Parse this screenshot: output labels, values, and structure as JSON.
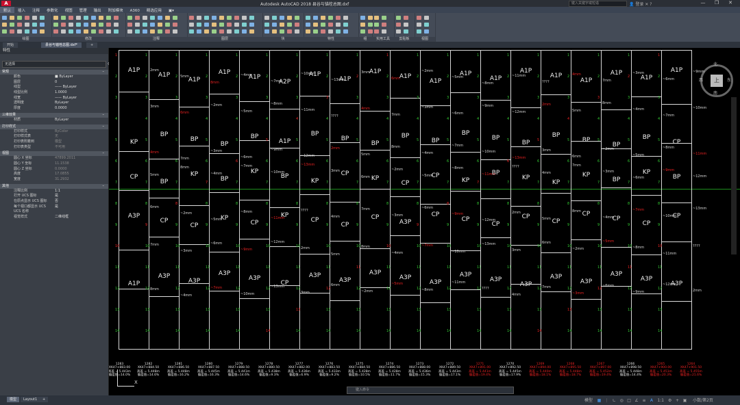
{
  "window": {
    "title": "Autodesk AutoCAD 2018    县谷与锚栓总图.dxf",
    "search_placeholder": "键入关键字或短语",
    "user": "登录",
    "controls": [
      "—",
      "❐",
      "✕"
    ]
  },
  "menu": [
    "默认",
    "插入",
    "注释",
    "参数化",
    "视图",
    "管理",
    "输出",
    "附加模块",
    "A360",
    "精选应用",
    "▣▾"
  ],
  "menu_active_index": 0,
  "ribbon": {
    "groups": [
      "绘图",
      "修改",
      "注释",
      "图层",
      "块",
      "特性",
      "组",
      "实用工具",
      "剪贴板",
      "视图"
    ],
    "draw_tools": [
      "直线",
      "多段线",
      "圆",
      "圆弧"
    ],
    "modify_tools": [
      "移动",
      "旋转",
      "修剪",
      "复制",
      "镜像",
      "圆角",
      "拉伸",
      "缩放",
      "阵列"
    ],
    "annot_tools": [
      "文字",
      "标注",
      "线性",
      "引线",
      "表格"
    ],
    "layer_tools": [
      "图层特性",
      "置为当前",
      "匹配图层"
    ],
    "block_tools": [
      "插入",
      "创建",
      "编辑",
      "编辑属性"
    ],
    "property_tools": [
      "特性匹配",
      "ByLayer",
      "ByLayer",
      "ByLayer"
    ],
    "group_tools": [
      "组"
    ],
    "util_tools": [
      "测量"
    ],
    "clip_tools": [
      "粘贴"
    ],
    "view_tools": [
      "基点"
    ]
  },
  "file_tabs": [
    "开始",
    "县谷与锚栓总图.dxf*",
    "+"
  ],
  "file_tab_active": 1,
  "palette": {
    "title": "特性",
    "selection": "无选择",
    "sections": [
      {
        "name": "常规",
        "rows": [
          [
            "颜色",
            "■ ByLayer"
          ],
          [
            "图层",
            "0"
          ],
          [
            "线型",
            "—— ByLayer"
          ],
          [
            "线型比例",
            "1.0000"
          ],
          [
            "线宽",
            "—— ByLayer"
          ],
          [
            "透明度",
            "ByLayer"
          ],
          [
            "厚度",
            "0.0000"
          ]
        ]
      },
      {
        "name": "三维效果",
        "rows": [
          [
            "材质",
            "ByLayer"
          ]
        ]
      },
      {
        "name": "打印样式",
        "rows": [
          [
            "打印样式",
            "ByColor"
          ],
          [
            "打印样式表",
            "无"
          ],
          [
            "打印表附着到",
            "模型"
          ],
          [
            "打印表类型",
            "不可用"
          ]
        ]
      },
      {
        "name": "视图",
        "rows": [
          [
            "圆心 X 坐标",
            "47899.2011"
          ],
          [
            "圆心 Y 坐标",
            "11.1538"
          ],
          [
            "圆心 Z 坐标",
            "0.0000"
          ],
          [
            "高度",
            "17.0855"
          ],
          [
            "宽度",
            "31.2932"
          ]
        ]
      },
      {
        "name": "其他",
        "rows": [
          [
            "注释比例",
            "1:1"
          ],
          [
            "打开 UCS 图标",
            "是"
          ],
          [
            "在原点显示 UCS 图标",
            "否"
          ],
          [
            "每个视口都显示 UCS",
            "是"
          ],
          [
            "UCS 名称",
            ""
          ],
          [
            "视觉样式",
            "二维线框"
          ]
        ]
      }
    ]
  },
  "canvas": {
    "columns": [
      {
        "labels": [
          "A1P",
          "KP",
          "CP",
          "A3P",
          "A1P"
        ],
        "info": [
          "1282",
          "XK47+884.50",
          "高差 = 5.448m",
          "偏差值=14.6%"
        ],
        "red": false
      },
      {
        "labels": [
          "A1P",
          "BP",
          "BP",
          "CP",
          "A3P"
        ],
        "info": [
          "1281",
          "XK47+886.50",
          "高差 = 5.448m",
          "偏差值=16.2%"
        ],
        "red": false
      },
      {
        "labels": [
          "A1P",
          "BP",
          "KP",
          "CP",
          "A3P"
        ],
        "info": [
          "1280",
          "XK47+887.50",
          "高差 = 5.445m",
          "偏差值=16.3%"
        ],
        "red": false
      },
      {
        "labels": [
          "A1P",
          "BP",
          "BP",
          "KP",
          "A3P"
        ],
        "info": [
          "1279",
          "XK47+888.50",
          "高差 = 5.441m",
          "偏差值=14.6%"
        ],
        "red": false
      },
      {
        "labels": [
          "A1P",
          "BP",
          "KP",
          "CP",
          "A3P"
        ],
        "info": [
          "1278",
          "XK47+880.50",
          "高差 = 5.438m",
          "偏差值=9.3%"
        ],
        "red": false
      },
      {
        "labels": [
          "A2P",
          "A1P",
          "BP",
          "KP",
          "CP"
        ],
        "info": [
          "1277",
          "XK47+882.00",
          "高差 = 5.436m",
          "偏差值=6.9%"
        ],
        "red": false
      },
      {
        "labels": [
          "A1P",
          "BP",
          "KP",
          "CP",
          "A3P"
        ],
        "info": [
          "1276",
          "XK47+883.50",
          "高差 = 5.433m",
          "偏差值=9.2%"
        ],
        "red": false
      },
      {
        "labels": [
          "A1P",
          "BP",
          "CP",
          "CP",
          "A3P"
        ],
        "info": [
          "1275",
          "XK47+884.50",
          "高差 = 5.428m",
          "偏差值=10.5%"
        ],
        "red": false
      },
      {
        "labels": [
          "A1P",
          "BP",
          "KP",
          "CP",
          "A3P"
        ],
        "info": [
          "1274",
          "XK47+886.50",
          "高差 = 5.428m",
          "偏差值=11.7%"
        ],
        "red": false
      },
      {
        "labels": [
          "A1P",
          "BP",
          "CP",
          "A3P",
          "A3P"
        ],
        "info": [
          "1273",
          "XK47+888.00",
          "高差 = 5.436m",
          "偏差值=15.3%"
        ],
        "red": false
      },
      {
        "labels": [
          "A1P",
          "BP",
          "CP",
          "CP",
          "A3P"
        ],
        "info": [
          "1272",
          "XK47+889.50",
          "高差 = 5.443m",
          "偏差值=17.1%"
        ],
        "red": false
      },
      {
        "labels": [
          "A1P",
          "BP",
          "KP",
          "CP",
          "A3P"
        ],
        "info": [
          "1271",
          "XK47+891.00",
          "高差 = 5.441m",
          "偏差值=19.4%"
        ],
        "red": true
      },
      {
        "labels": [
          "A1P",
          "BP",
          "BP",
          "CP",
          "A3P"
        ],
        "info": [
          "1270",
          "XK47+892.50",
          "高差 = 5.445m",
          "偏差值=17.9%"
        ],
        "red": false
      },
      {
        "labels": [
          "A1P",
          "BP",
          "KP",
          "CP",
          "A3P"
        ],
        "info": [
          "1269",
          "XK47+894.00",
          "高差 = 5.440m",
          "偏差值=18.1%"
        ],
        "red": true
      },
      {
        "labels": [
          "A1P",
          "BP",
          "KP",
          "CP",
          "A3P"
        ],
        "info": [
          "1268",
          "XK47+895.50",
          "高差 = 5.448m",
          "偏差值=18.7%"
        ],
        "red": true
      },
      {
        "labels": [
          "A1P",
          "BP",
          "KP",
          "CP",
          "A3P"
        ],
        "info": [
          "1267",
          "XK47+897.00",
          "高差 = 5.452m",
          "偏差值=19.4%"
        ],
        "red": true
      },
      {
        "labels": [
          "A1P",
          "BP",
          "BP",
          "CP",
          "A3P"
        ],
        "info": [
          "1266",
          "XK47+898.50",
          "高差 = 5.448m",
          "偏差值=14.4%"
        ],
        "red": false
      },
      {
        "labels": [
          "A1P",
          "BP",
          "KP",
          "CP",
          "A3P"
        ],
        "info": [
          "1265",
          "XK47+900.00",
          "高差 = 5.451m",
          "偏差值=20.3%"
        ],
        "red": true
      },
      {
        "labels": [
          "A1P",
          "CP",
          "BP",
          "CP",
          "A3P"
        ],
        "info": [
          "1264",
          "XK47+901.50",
          "高差 = 5.455m",
          "偏差值=21.6%"
        ],
        "red": true
      }
    ],
    "left_info": [
      "1283",
      "XK47+883.00",
      "高差 = 5.443m",
      "偏差值=14.0%"
    ],
    "measures": [
      "2mm",
      "3mm",
      "4mm",
      "5mm",
      "6mm",
      "7mm",
      "8mm",
      "~2mm",
      "~3mm",
      "~4mm",
      "~5mm",
      "~6mm",
      "~7mm",
      "~8mm",
      "~9mm",
      "~10mm",
      "~11mm",
      "~12mm",
      "~13mm",
      "????"
    ],
    "viewcube": {
      "top": "上",
      "n": "北",
      "s": "南",
      "e": "东",
      "w": "西"
    },
    "command_placeholder": "键入命令",
    "ucs_x": "X"
  },
  "status": {
    "layout_tabs": [
      "模型",
      "Layout1",
      "+"
    ],
    "model_label": "模型",
    "scale": "1:1",
    "right_label": "小数/第2页"
  }
}
